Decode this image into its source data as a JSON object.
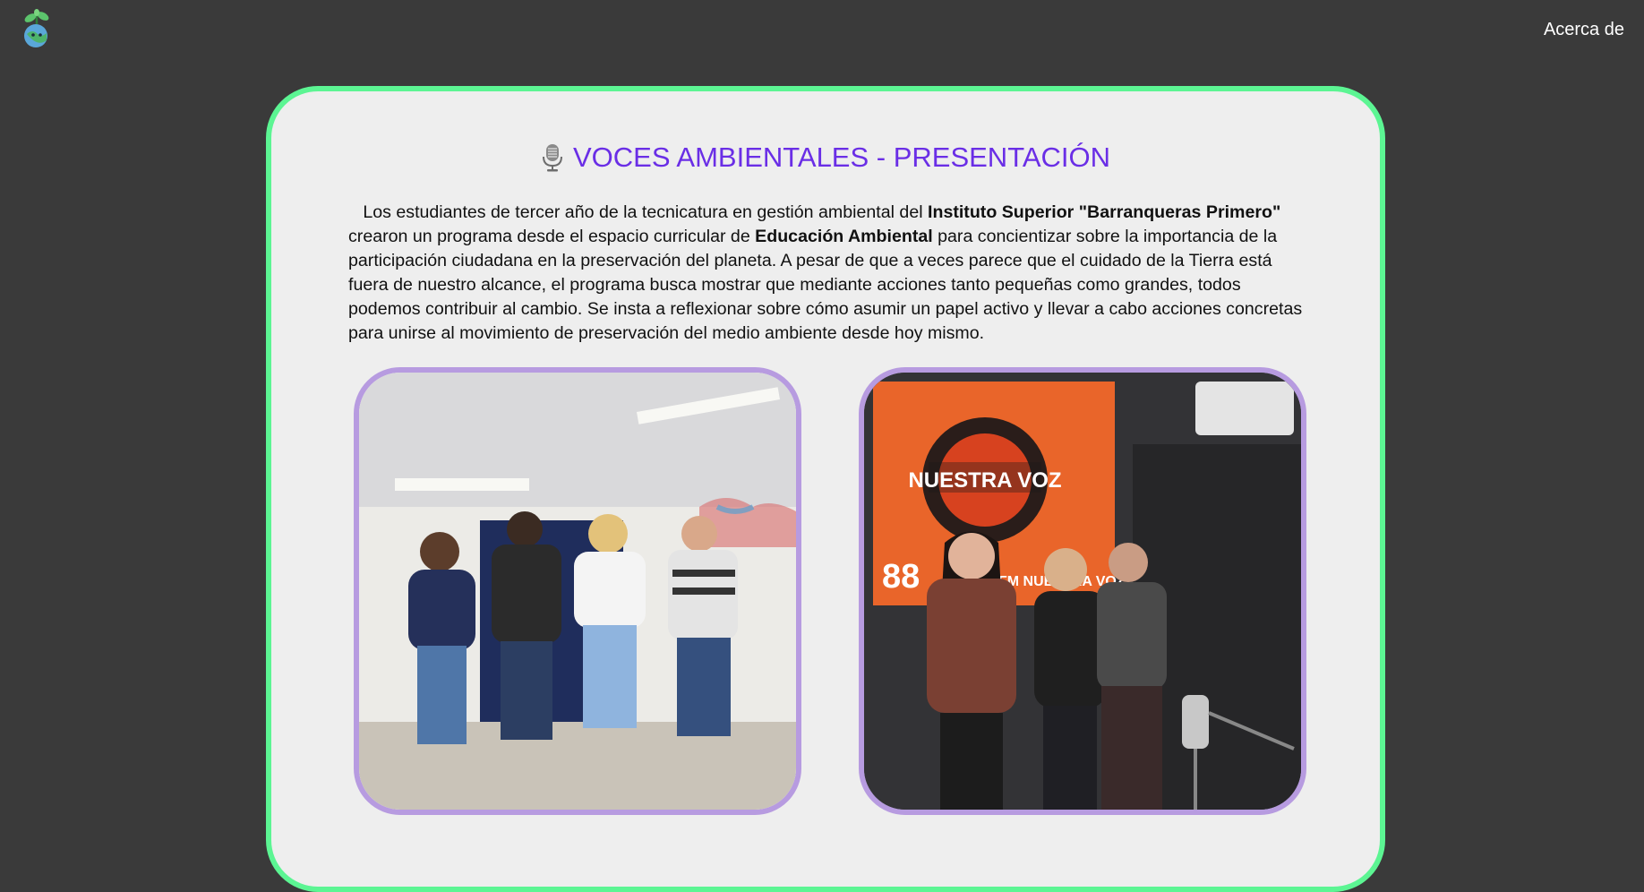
{
  "header": {
    "logo_icon": "plant-globe-mascot-icon",
    "nav": {
      "about_label": "Acerca de"
    }
  },
  "main": {
    "title": "VOCES AMBIENTALES - PRESENTACIÓN",
    "title_icon": "microphone-icon",
    "intro": {
      "part1": "Los estudiantes de tercer año de la tecnicatura en gestión ambiental del ",
      "institute": "Instituto Superior \"Barranqueras Primero\"",
      "part2": " crearon un programa desde el espacio curricular de ",
      "subject": "Educación Ambiental",
      "part3": " para concientizar sobre la importancia de la participación ciudadana en la preservación del planeta. A pesar de que a veces parece que el cuidado de la Tierra está fuera de nuestro alcance, el programa busca mostrar que mediante acciones tanto pequeñas como grandes, todos podemos contribuir al cambio. Se insta a reflexionar sobre cómo asumir un papel activo y llevar a cabo acciones concretas para unirse al movimiento de preservación del medio ambiente desde hoy mismo."
    },
    "photos": [
      {
        "icon": "group-photo-office"
      },
      {
        "icon": "group-photo-radio-studio",
        "banner_text": "NUESTRA VOZ",
        "banner_sub": "88",
        "banner_fm": "FM NUESTRA VOZ"
      }
    ]
  },
  "colors": {
    "background": "#3a3a3a",
    "card_bg": "#eeeeee",
    "card_border": "#5cf593",
    "title": "#6a2ee6",
    "photo_border": "#b79be0"
  }
}
